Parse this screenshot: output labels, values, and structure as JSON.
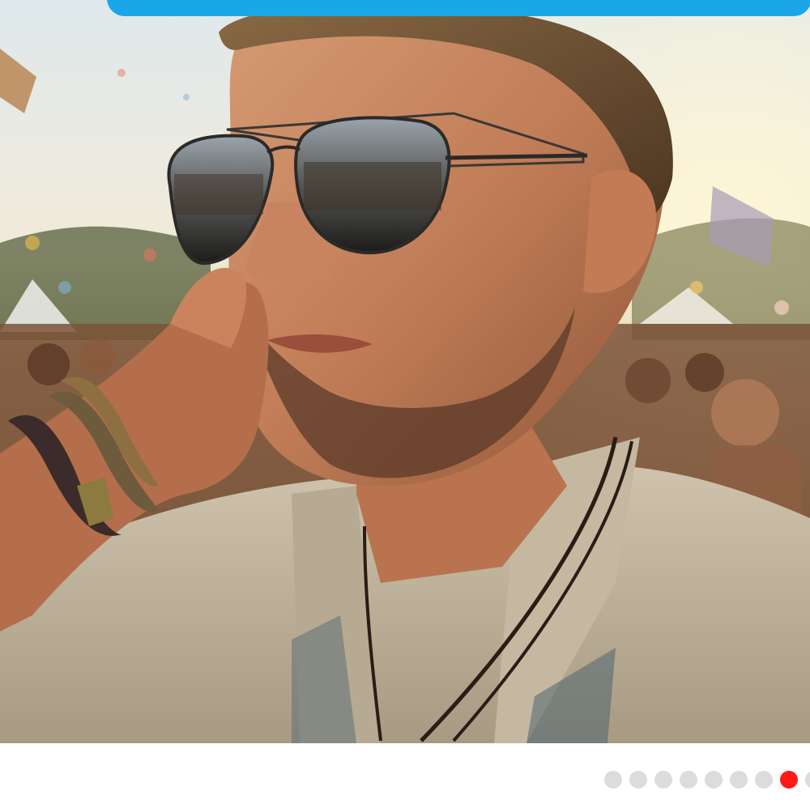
{
  "carousel": {
    "total_visible_dots": 9,
    "active_index": 7,
    "active_color": "#ff1a1a",
    "inactive_color": "#dcdcdc"
  },
  "banner": {
    "color": "#1aa7e8"
  },
  "photo": {
    "subject_icon": "festival-portrait-image"
  }
}
